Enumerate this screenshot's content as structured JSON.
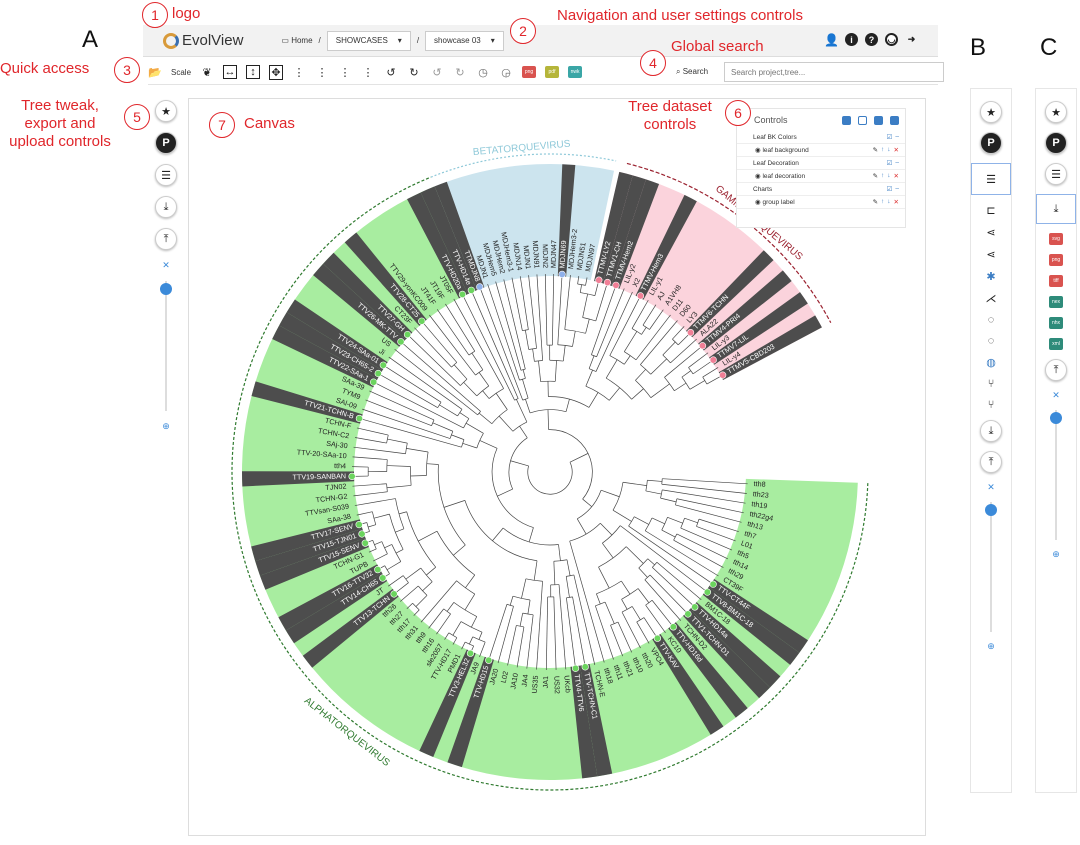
{
  "panels": {
    "a": "A",
    "b": "B",
    "c": "C"
  },
  "annotations": [
    {
      "num": "1",
      "text": "logo"
    },
    {
      "num": "2",
      "text": "Navigation and user settings controls"
    },
    {
      "num": "3",
      "text": "Quick access"
    },
    {
      "num": "4",
      "text": "Global search"
    },
    {
      "num": "5",
      "text": "Tree tweak,\nexport and\nupload controls"
    },
    {
      "num": "6",
      "text": "Tree dataset\ncontrols"
    },
    {
      "num": "7",
      "text": "Canvas"
    }
  ],
  "topbar": {
    "logo": "EvolView",
    "home": "Home",
    "sep": "/",
    "project": "SHOWCASES",
    "showcase": "showcase 03",
    "user_icons": [
      "add-user-icon",
      "info-icon",
      "help-icon",
      "account-icon",
      "logout-icon"
    ]
  },
  "quick": {
    "scale": "Scale",
    "search_label": "Search",
    "search_placeholder": "Search project,tree...",
    "formats": [
      {
        "label": "png",
        "color": "#d9534f"
      },
      {
        "label": "pdf",
        "color": "#b5b53a"
      },
      {
        "label": "nwk",
        "color": "#3aa6a6"
      }
    ]
  },
  "side_c_formats": [
    {
      "label": "svg",
      "color": "#d9534f"
    },
    {
      "label": "png",
      "color": "#d9534f"
    },
    {
      "label": "tiff",
      "color": "#d9534f"
    },
    {
      "label": "nex",
      "color": "#2e8b7a"
    },
    {
      "label": "nhx",
      "color": "#2e8b7a"
    },
    {
      "label": "xml",
      "color": "#2e8b7a"
    }
  ],
  "controls": {
    "title": "Controls",
    "sections": [
      {
        "heading": "Leaf BK Colors",
        "item": "leaf background"
      },
      {
        "heading": "Leaf Decoration",
        "item": "leaf decoration"
      },
      {
        "heading": "Charts",
        "item": "group label"
      }
    ]
  },
  "colors": {
    "alpha": "#a8eda0",
    "beta": "#cce4ee",
    "gamma": "#fbd3dc",
    "dark": "#4d4d4d",
    "dot_alpha": "#6bd45e",
    "dot_beta": "#8fb0ea",
    "dot_gamma": "#f07f96",
    "annot": "#e0262b"
  },
  "tree": {
    "clades": [
      {
        "name": "BETATORQUEVIRUS",
        "key": "beta"
      },
      {
        "name": "GAMMATORQUEVIRUS",
        "key": "gamma"
      },
      {
        "name": "ALPHATORQUEVIRUS",
        "key": "alpha"
      }
    ],
    "leaves": {
      "beta": [
        [
          "TTMDJN8",
          1
        ],
        [
          "MDJN1",
          0
        ],
        [
          "MDJHem5",
          0
        ],
        [
          "MDJHem2",
          0
        ],
        [
          "MDJHem3-1",
          0
        ],
        [
          "MDJN14",
          0
        ],
        [
          "MDJN1",
          0
        ],
        [
          "MDJN91",
          0
        ],
        [
          "MDJN2",
          0
        ],
        [
          "MDJN47",
          0
        ],
        [
          "MDJN69",
          1
        ],
        [
          "MDJHem3-2",
          0
        ],
        [
          "MDJN51",
          0
        ],
        [
          "MDJN97",
          0
        ]
      ],
      "gamma": [
        [
          "TTMV-LY2",
          1
        ],
        [
          "TTMV1-CH",
          1
        ],
        [
          "TTMV-Hem2",
          1
        ],
        [
          "LIL-y2",
          0
        ],
        [
          "X2",
          0
        ],
        [
          "TTMV-Hem3",
          1
        ],
        [
          "LIL-y1",
          0
        ],
        [
          "AJ",
          0
        ],
        [
          "A1VH8",
          0
        ],
        [
          "D11",
          0
        ],
        [
          "D60",
          0
        ],
        [
          "LY3",
          0
        ],
        [
          "TTMV6-TCHN",
          1
        ],
        [
          "ALA22",
          0
        ],
        [
          "TTMV4-PRI4",
          1
        ],
        [
          "LIL-y3",
          0
        ],
        [
          "TTMV7-LIL",
          1
        ],
        [
          "LIL-y4",
          0
        ],
        [
          "TTMV5-CBD203",
          1
        ]
      ],
      "alpha": [
        [
          "tth8",
          0
        ],
        [
          "tth23",
          0
        ],
        [
          "tth19",
          0
        ],
        [
          "tth22g4",
          0
        ],
        [
          "tth13",
          0
        ],
        [
          "tth7",
          0
        ],
        [
          "L01",
          0
        ],
        [
          "tth5",
          0
        ],
        [
          "tth14",
          0
        ],
        [
          "tth29",
          0
        ],
        [
          "CT39F",
          0
        ],
        [
          "TTV-CT44F",
          1
        ],
        [
          "TTV8-BM1C-18",
          1
        ],
        [
          "BM1C-18",
          0
        ],
        [
          "TTV-HD14a",
          1
        ],
        [
          "TTV1-TCHN-D1",
          1
        ],
        [
          "TCHN-D2",
          0
        ],
        [
          "TTV-HD16d",
          1
        ],
        [
          "KC10",
          0
        ],
        [
          "TTV-KAV",
          1
        ],
        [
          "VPO4",
          0
        ],
        [
          "tth20",
          0
        ],
        [
          "tth10",
          0
        ],
        [
          "tth21",
          0
        ],
        [
          "tth11",
          0
        ],
        [
          "tth18",
          0
        ],
        [
          "TCHN-E",
          0
        ],
        [
          "TTV-TCHN-C1",
          1
        ],
        [
          "TTV4-TTV6",
          1
        ],
        [
          "UKcb",
          0
        ],
        [
          "US32",
          0
        ],
        [
          "JA1",
          0
        ],
        [
          "US35",
          0
        ],
        [
          "JA4",
          0
        ],
        [
          "JA10",
          0
        ],
        [
          "L02",
          0
        ],
        [
          "JA20",
          0
        ],
        [
          "TTV-HD15",
          1
        ],
        [
          "JA9",
          0
        ],
        [
          "TTV3-HEL32",
          1
        ],
        [
          "PMD1",
          0
        ],
        [
          "TTV-HD17",
          0
        ],
        [
          "sle2057",
          0
        ],
        [
          "tth16",
          0
        ],
        [
          "tth9",
          0
        ],
        [
          "tth31",
          0
        ],
        [
          "tth17",
          0
        ],
        [
          "tth27",
          0
        ],
        [
          "tth26",
          0
        ],
        [
          "TTV13-TCHN",
          1
        ],
        [
          "JT",
          0
        ],
        [
          "TTV14-CH65",
          1
        ],
        [
          "TTV16-TTV32",
          1
        ],
        [
          "TUPB",
          0
        ],
        [
          "TCHN-G1",
          0
        ],
        [
          "TTV15-SENV",
          1
        ],
        [
          "TTV15-TJN01",
          1
        ],
        [
          "TTV17-SENV",
          1
        ],
        [
          "SAa-38",
          0
        ],
        [
          "TTVsan-S039",
          0
        ],
        [
          "TCHN-G2",
          0
        ],
        [
          "TJN02",
          0
        ],
        [
          "TTV19-SANBAN",
          1
        ],
        [
          "tth4",
          0
        ],
        [
          "TTV-20-SAa-10",
          0
        ],
        [
          "SAj-30",
          0
        ],
        [
          "TCHN-C2",
          0
        ],
        [
          "TCHN-F",
          0
        ],
        [
          "TTV21-TCHN-B",
          1
        ],
        [
          "SAl-09",
          0
        ],
        [
          "TYM9",
          0
        ],
        [
          "SAa-39",
          0
        ],
        [
          "TTV22-SAa-1",
          1
        ],
        [
          "TTV23-CH65-2",
          1
        ],
        [
          "TTV24-SAa-01",
          1
        ],
        [
          "Ji",
          0
        ],
        [
          "US",
          0
        ],
        [
          "TTV26-MK-TTV",
          1
        ],
        [
          "TTV27-GH",
          1
        ],
        [
          "CT23F",
          0
        ],
        [
          "TTV28-CT25",
          1
        ],
        [
          "TTV29-yonKC009",
          0
        ],
        [
          "JT41F",
          0
        ],
        [
          "JT19F",
          0
        ],
        [
          "JT05F",
          0
        ],
        [
          "TTV-HD20a",
          1
        ],
        [
          "TTV-HD14e",
          1
        ]
      ]
    }
  }
}
